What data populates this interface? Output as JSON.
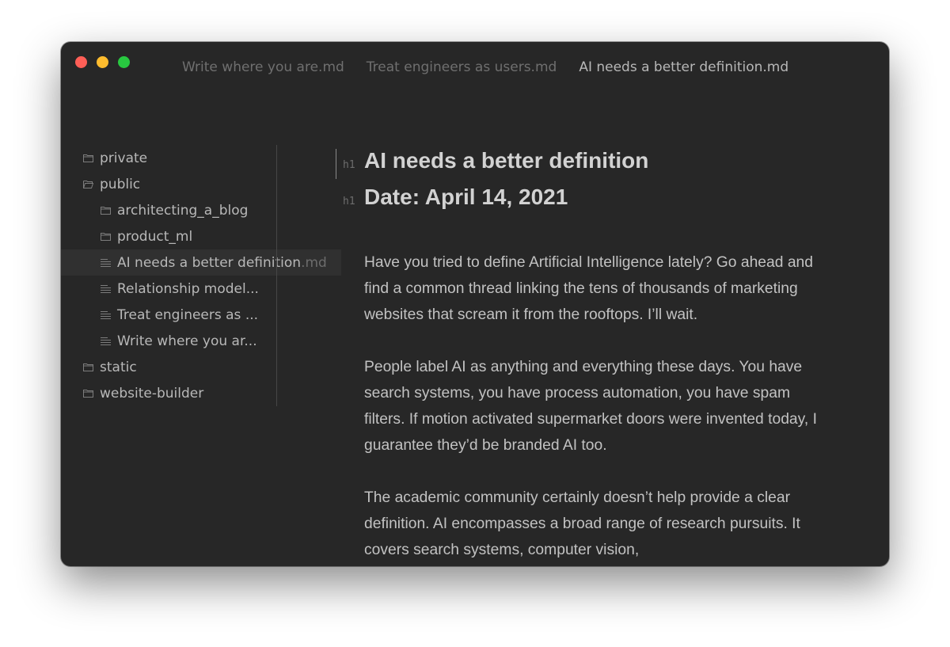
{
  "tabs": [
    {
      "label": "Write where you are.md"
    },
    {
      "label": "Treat engineers as users.md"
    },
    {
      "label": "AI needs a better definition.md",
      "active": true
    }
  ],
  "sidebar": {
    "items": [
      {
        "label": "private",
        "type": "folder",
        "level": 0
      },
      {
        "label": "public",
        "type": "folder-open",
        "level": 0
      },
      {
        "label": "architecting_a_blog",
        "type": "folder",
        "level": 1
      },
      {
        "label": "product_ml",
        "type": "folder",
        "level": 1
      },
      {
        "label": "AI needs a better definition",
        "ext": ".md",
        "type": "file",
        "level": 1,
        "selected": true
      },
      {
        "label": "Relationship model...",
        "type": "file",
        "level": 1
      },
      {
        "label": "Treat engineers as ...",
        "type": "file",
        "level": 1
      },
      {
        "label": "Write where you ar...",
        "type": "file",
        "level": 1
      },
      {
        "label": "static",
        "type": "folder",
        "level": 0
      },
      {
        "label": "website-builder",
        "type": "folder",
        "level": 0
      }
    ]
  },
  "editor": {
    "heading_marker": "h1",
    "title": "AI needs a better definition",
    "date_heading": "Date: April 14, 2021",
    "paragraphs": [
      "Have you tried to define Artificial Intelligence lately? Go ahead and find a common thread linking the tens of thousands of marketing websites that scream it from the rooftops. I’ll wait.",
      "People label AI as anything and everything these days. You have search systems, you have process automation, you have spam filters. If motion activated supermarket doors were invented today, I guarantee they’d be branded AI too.",
      "The academic community certainly doesn’t help provide a clear definition. AI encompasses a broad range of research pursuits. It covers search systems, computer vision,"
    ]
  },
  "colors": {
    "window_bg": "#272727",
    "close": "#ff5f57",
    "minimize": "#febc2e",
    "maximize": "#28c840"
  }
}
